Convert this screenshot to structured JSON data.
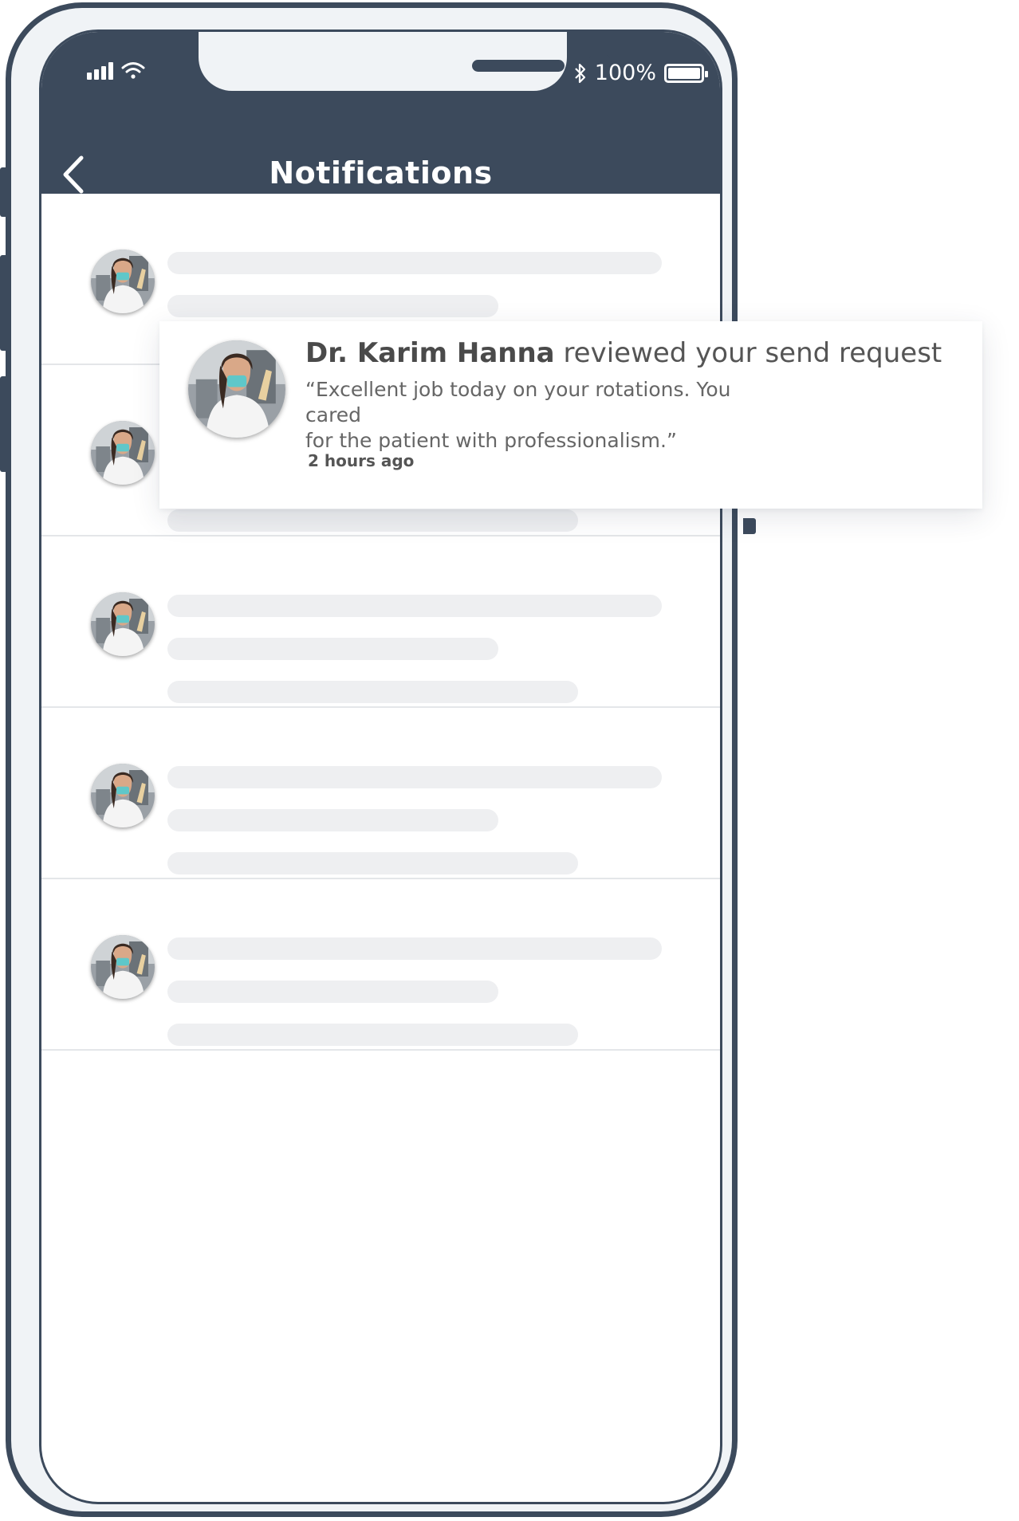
{
  "status_bar": {
    "battery": "100%"
  },
  "header": {
    "title": "Notifications"
  },
  "notification_card": {
    "sender": "Dr. Karim Hanna",
    "action": "reviewed your send request",
    "quote_line1": "“Excellent job today on your rotations. You cared",
    "quote_line2": "for the patient with professionalism.”",
    "time": "2 hours ago"
  },
  "colors": {
    "header": "#3c4a5c",
    "skeleton": "#eeeff1",
    "background": "#ffffff"
  },
  "icons": [
    "cellular-signal-icon",
    "wifi-icon",
    "bluetooth-icon",
    "battery-icon",
    "back-arrow-icon"
  ]
}
